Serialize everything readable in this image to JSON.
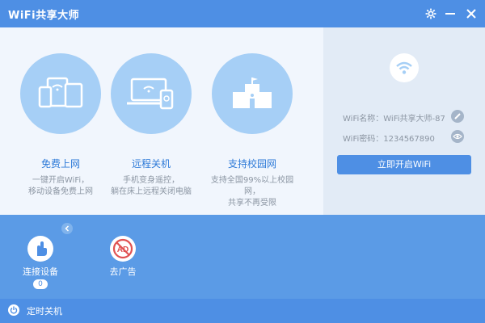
{
  "app": {
    "title": "WiFi共享大师"
  },
  "titlebar": {
    "settings_icon": "gear-icon",
    "minimize_icon": "minimize-icon",
    "close_icon": "close-icon"
  },
  "features": [
    {
      "name": "免费上网",
      "desc_line1": "一键开启WiFi，",
      "desc_line2": "移动设备免费上网",
      "icon": "devices-icon"
    },
    {
      "name": "远程关机",
      "desc_line1": "手机变身遥控，",
      "desc_line2": "躺在床上远程关闭电脑",
      "icon": "laptop-phone-icon"
    },
    {
      "name": "支持校园网",
      "desc_line1": "支持全国99%以上校园网，",
      "desc_line2": "共享不再受限",
      "icon": "school-icon"
    }
  ],
  "wifi": {
    "name_label": "WiFi名称：",
    "name_value": "WiFi共享大师-87",
    "password_label": "WiFi密码：",
    "password_value": "1234567890",
    "start_button": "立即开启WiFi"
  },
  "tools": {
    "connected_label": "连接设备",
    "connected_count": "0",
    "remove_ads_label": "去广告"
  },
  "bottom": {
    "shutdown_label": "定时关机"
  },
  "colors": {
    "accent": "#4e8fe4",
    "body": "#5b9be6",
    "feature_bg": "#f1f6fd",
    "circle": "#a6cff6",
    "feature_text": "#2d7ad8"
  }
}
